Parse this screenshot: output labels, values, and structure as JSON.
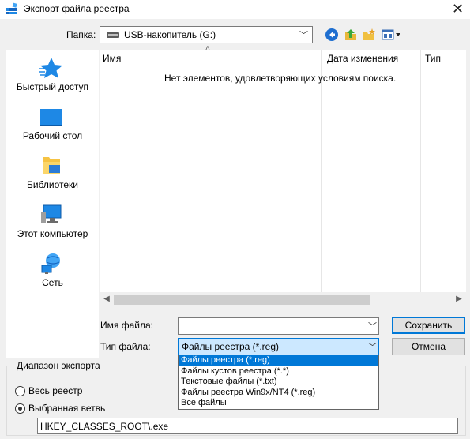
{
  "window": {
    "title": "Экспорт файла реестра",
    "close_glyph": "✕"
  },
  "folder": {
    "label": "Папка:",
    "value": "USB-накопитель (G:)"
  },
  "places": [
    {
      "label": "Быстрый доступ",
      "icon": "star-icon"
    },
    {
      "label": "Рабочий стол",
      "icon": "desktop-icon"
    },
    {
      "label": "Библиотеки",
      "icon": "libraries-icon"
    },
    {
      "label": "Этот компьютер",
      "icon": "computer-icon"
    },
    {
      "label": "Сеть",
      "icon": "network-icon"
    }
  ],
  "filelist": {
    "columns": [
      "Имя",
      "Дата изменения",
      "Тип"
    ],
    "empty_message": "Нет элементов, удовлетворяющих условиям поиска."
  },
  "filename": {
    "label": "Имя файла:",
    "value": ""
  },
  "filetype": {
    "label": "Тип файла:",
    "value": "Файлы реестра (*.reg)",
    "options": [
      "Файлы реестра (*.reg)",
      "Файлы кустов реестра (*.*)",
      "Текстовые файлы (*.txt)",
      "Файлы реестра Win9x/NT4 (*.reg)",
      "Все файлы"
    ],
    "selected_index": 0
  },
  "buttons": {
    "save": "Сохранить",
    "cancel": "Отмена"
  },
  "export_range": {
    "title": "Диапазон экспорта",
    "option_all": "Весь реестр",
    "option_branch": "Выбранная ветвь",
    "selected": "option_branch",
    "branch_value": "HKEY_CLASSES_ROOT\\.exe"
  },
  "colors": {
    "accent": "#0078d7",
    "selection": "#cce8ff"
  }
}
